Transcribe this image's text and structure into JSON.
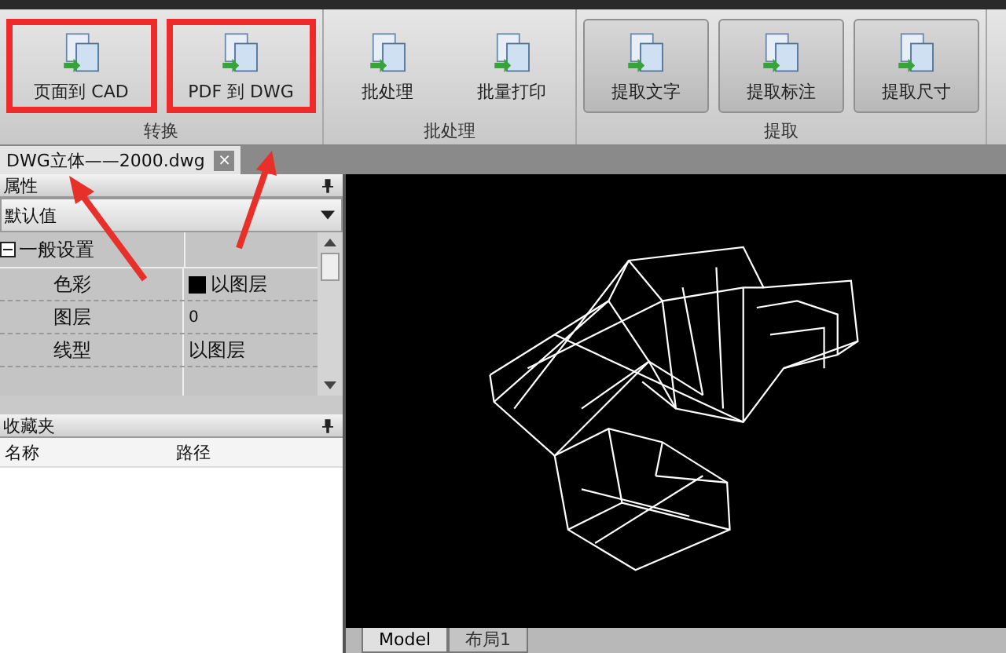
{
  "ribbon": {
    "groups": [
      {
        "label": "转换",
        "kind": "flat",
        "buttons": [
          {
            "label": "页面到 CAD",
            "highlighted": true
          },
          {
            "label": "PDF 到 DWG",
            "highlighted": true
          }
        ]
      },
      {
        "label": "批处理",
        "kind": "flat",
        "buttons": [
          {
            "label": "批处理",
            "highlighted": false
          },
          {
            "label": "批量打印",
            "highlighted": false
          }
        ]
      },
      {
        "label": "提取",
        "kind": "raised",
        "buttons": [
          {
            "label": "提取文字",
            "highlighted": false
          },
          {
            "label": "提取标注",
            "highlighted": false
          },
          {
            "label": "提取尺寸",
            "highlighted": false
          }
        ]
      }
    ]
  },
  "document_tab": {
    "title": "DWG立体——2000.dwg",
    "close": "×"
  },
  "properties": {
    "title": "属性",
    "dropdown": "默认值",
    "category": {
      "label": "一般设置",
      "expanded": true
    },
    "rows": [
      {
        "name": "色彩",
        "value": "以图层",
        "kind": "swatch"
      },
      {
        "name": "图层",
        "value": "0",
        "kind": "small"
      },
      {
        "name": "线型",
        "value": "以图层",
        "kind": "text"
      }
    ]
  },
  "favorites": {
    "title": "收藏夹",
    "columns": [
      "名称",
      "路径"
    ]
  },
  "layout_tabs": [
    {
      "label": "Model",
      "selected": true
    },
    {
      "label": "布局1",
      "selected": false
    }
  ]
}
